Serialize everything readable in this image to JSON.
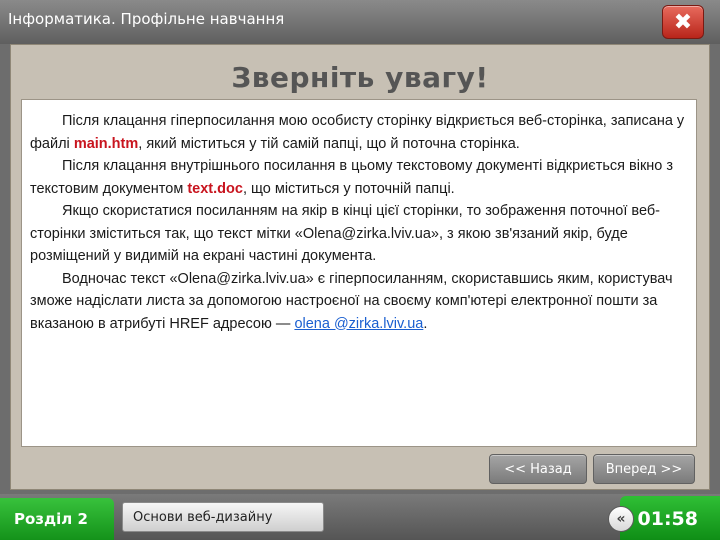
{
  "window": {
    "title": "Інформатика. Профільне навчання",
    "title_bullet": "",
    "close_glyph": "✖"
  },
  "slide": {
    "heading": "Зверніть увагу!",
    "paragraphs": {
      "p1": {
        "before": "Після клацання гіперпосилання мою особисту сторінку відкриється веб-сторінка, записана у файлі ",
        "file": "main.htm",
        "after": ", який міститься у тій самій папці, що й поточна сторінка."
      },
      "p2": {
        "before": "Після клацання внутрішнього посилання в цьому текстовому документі відкриється вікно з текстовим документом ",
        "file": "text.doc",
        "after": ", що міститься у поточній папці."
      },
      "p3": {
        "text": "Якщо скористатися посиланням на якір в кінці цієї сторінки, то зображення поточної веб-сторінки зміститься так, що текст мітки «Olena@zirka.lviv.ua», з якою зв'язаний якір, буде розміщений у видимій на екрані частині документа."
      },
      "p4": {
        "before": "Водночас текст «Olena@zirka.lviv.ua» є гіперпосиланням, скориставшись яким, користувач зможе надіслати листа за допомогою настроєної на своєму комп'ютері електронної пошти за вказаною в атрибуті HREF адресою — ",
        "link": "olena @zirka.lviv.ua",
        "after": "."
      }
    }
  },
  "nav": {
    "prev_label": "<< Назад",
    "next_label": "Вперед >>"
  },
  "footer": {
    "section_bullet": "",
    "section_label": "Розділ 2",
    "topic_bullet": "",
    "topic_label": "Основи веб-дизайну",
    "timer_icon_glyph": "«",
    "timer": "01:58"
  },
  "colors": {
    "highlight": "#c8141e",
    "link": "#1a5fd0",
    "accent_green": "#14921a"
  }
}
